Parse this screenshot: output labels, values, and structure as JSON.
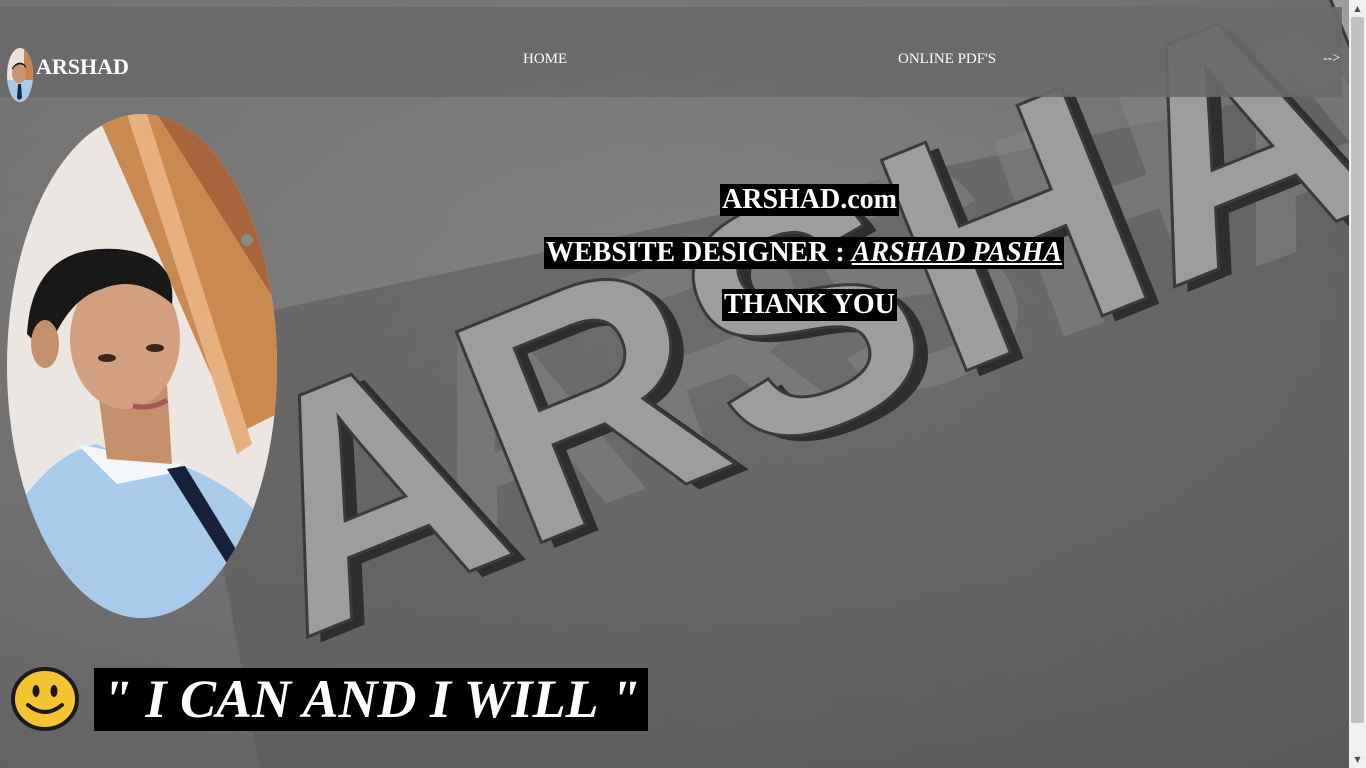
{
  "navbar": {
    "brand": "ARSHAD",
    "avatar_icon": "profile-photo",
    "links": [
      {
        "label": "HOME"
      },
      {
        "label": "ONLINE PDF'S"
      }
    ],
    "stray_text": "-->"
  },
  "background": {
    "watermark_text": "ARSHAD"
  },
  "hero": {
    "site": "ARSHAD.com",
    "designer_label": "WEBSITE DESIGNER : ",
    "designer_name": "ARSHAD PASHA",
    "thanks": "THANK YOU"
  },
  "quote": {
    "text": "\" I CAN AND I WILL \"",
    "emoji_icon": "smiley-face"
  },
  "colors": {
    "heading_bg": "#000000",
    "heading_text": "#ffffff",
    "navbar_bg": "#696969"
  }
}
